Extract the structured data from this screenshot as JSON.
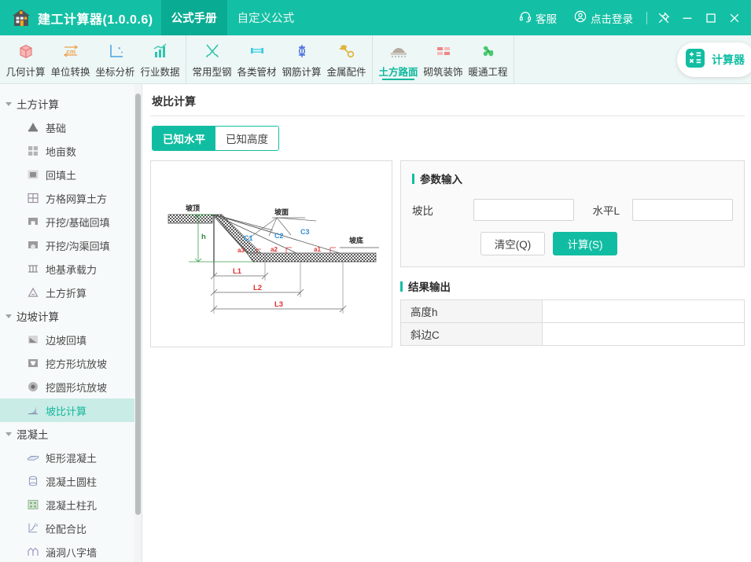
{
  "titlebar": {
    "logo_icon": "house-calculator-icon",
    "app_title": "建工计算器(1.0.0.6)",
    "tabs": [
      {
        "label": "公式手册",
        "active": true
      },
      {
        "label": "自定义公式",
        "active": false
      }
    ],
    "actions": [
      {
        "icon": "headset-icon",
        "label": "客服"
      },
      {
        "icon": "user-circle-icon",
        "label": "点击登录"
      }
    ],
    "window_controls": [
      {
        "icon": "pin-icon",
        "label": "置顶"
      },
      {
        "icon": "minimize-icon",
        "label": "最小化"
      },
      {
        "icon": "maximize-icon",
        "label": "最大化"
      },
      {
        "icon": "close-icon",
        "label": "关闭"
      }
    ]
  },
  "toolbar": {
    "groups": [
      {
        "items": [
          {
            "label": "几何计算",
            "icon": "cube-icon",
            "color": "#f08c8c",
            "active": false
          },
          {
            "label": "单位转换",
            "icon": "cm-convert-icon",
            "color": "#f0a04b",
            "active": false
          },
          {
            "label": "坐标分析",
            "icon": "axes-icon",
            "color": "#4b9fe0",
            "active": false
          },
          {
            "label": "行业数据",
            "icon": "bar-chart-icon",
            "color": "#2fc4ae",
            "active": false
          }
        ]
      },
      {
        "items": [
          {
            "label": "常用型钢",
            "icon": "tools-icon",
            "color": "#2fc4ae",
            "active": false
          },
          {
            "label": "各类管材",
            "icon": "pipe-icon",
            "color": "#3fc8de",
            "active": false
          },
          {
            "label": "钢筋计算",
            "icon": "rebar-icon",
            "color": "#4b6fe0",
            "active": false
          },
          {
            "label": "金属配件",
            "icon": "wrench-icon",
            "color": "#e0b53f",
            "active": false
          }
        ]
      },
      {
        "items": [
          {
            "label": "土方路面",
            "icon": "roadbed-icon",
            "color": "#9a9a8e",
            "active": true
          },
          {
            "label": "砌筑装饰",
            "icon": "brick-icon",
            "color": "#e06a6a",
            "active": false
          },
          {
            "label": "暖通工程",
            "icon": "fan-icon",
            "color": "#3fc46a",
            "active": false
          }
        ]
      }
    ],
    "calculator_pill": {
      "label": "计算器",
      "icon": "calculator-icon"
    }
  },
  "sidebar": {
    "groups": [
      {
        "title": "土方计算",
        "expanded": true,
        "items": [
          {
            "label": "基础",
            "icon": "foundation-icon",
            "selected": false
          },
          {
            "label": "地亩数",
            "icon": "land-area-icon",
            "selected": false
          },
          {
            "label": "回填土",
            "icon": "backfill-icon",
            "selected": false
          },
          {
            "label": "方格网算土方",
            "icon": "grid-earthwork-icon",
            "selected": false
          },
          {
            "label": "开挖/基础回填",
            "icon": "excavation-foundation-icon",
            "selected": false
          },
          {
            "label": "开挖/沟渠回填",
            "icon": "excavation-trench-icon",
            "selected": false
          },
          {
            "label": "地基承载力",
            "icon": "bearing-capacity-icon",
            "selected": false
          },
          {
            "label": "土方折算",
            "icon": "earthwork-convert-icon",
            "selected": false
          }
        ]
      },
      {
        "title": "边坡计算",
        "expanded": true,
        "items": [
          {
            "label": "边坡回填",
            "icon": "slope-backfill-icon",
            "selected": false
          },
          {
            "label": "挖方形坑放坡",
            "icon": "square-pit-slope-icon",
            "selected": false
          },
          {
            "label": "挖圆形坑放坡",
            "icon": "round-pit-slope-icon",
            "selected": false
          },
          {
            "label": "坡比计算",
            "icon": "slope-ratio-icon",
            "selected": true
          }
        ]
      },
      {
        "title": "混凝土",
        "expanded": true,
        "items": [
          {
            "label": "矩形混凝土",
            "icon": "rect-concrete-icon",
            "selected": false
          },
          {
            "label": "混凝土圆柱",
            "icon": "cylinder-concrete-icon",
            "selected": false
          },
          {
            "label": "混凝土柱孔",
            "icon": "concrete-hole-icon",
            "selected": false
          },
          {
            "label": "砼配合比",
            "icon": "mix-ratio-icon",
            "selected": false
          },
          {
            "label": "涵洞八字墙",
            "icon": "culvert-wall-icon",
            "selected": false
          }
        ]
      }
    ]
  },
  "main": {
    "page_title": "坡比计算",
    "segments": [
      {
        "label": "已知水平",
        "active": true
      },
      {
        "label": "已知高度",
        "active": false
      }
    ],
    "input_panel": {
      "title": "参数输入",
      "fields": [
        {
          "label": "坡比",
          "value": "",
          "placeholder": ""
        },
        {
          "label": "水平L",
          "value": "",
          "placeholder": ""
        }
      ],
      "buttons": [
        {
          "label": "清空(Q)",
          "primary": false
        },
        {
          "label": "计算(S)",
          "primary": true
        }
      ]
    },
    "output_panel": {
      "title": "结果输出",
      "rows": [
        {
          "key": "高度h",
          "value": ""
        },
        {
          "key": "斜边C",
          "value": ""
        }
      ]
    },
    "diagram": {
      "name": "slope-ratio-diagram",
      "labels": {
        "top": "坡顶",
        "face": "坡面",
        "bottom": "坡底",
        "height": "h",
        "c1": "C1",
        "c2": "C2",
        "c3": "C3",
        "a1": "a1",
        "a2": "a2",
        "a3": "a3",
        "l1": "L1",
        "l2": "L2",
        "l3": "L3"
      },
      "colors": {
        "height": "#2e8b3d",
        "hypotenuse": "#2f8fd8",
        "angle": "#e03030",
        "length": "#e03030",
        "text": "#222222"
      }
    }
  }
}
